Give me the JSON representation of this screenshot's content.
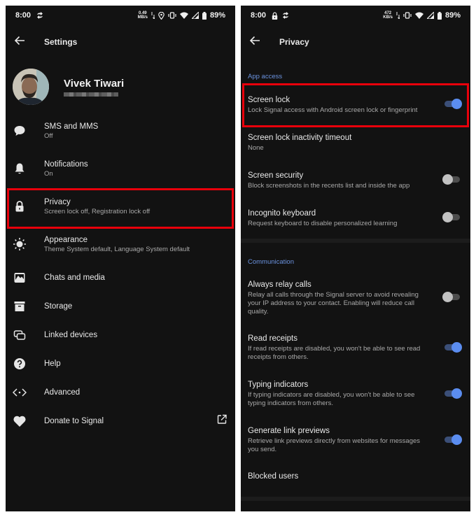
{
  "left": {
    "status_bar": {
      "time": "8:00",
      "net_speed_value": "0.49",
      "net_speed_unit": "MB/s",
      "battery": "89%"
    },
    "app_bar": {
      "title": "Settings"
    },
    "profile": {
      "name": "Vivek Tiwari"
    },
    "menu": [
      {
        "label": "SMS and MMS",
        "sub": "Off",
        "icon": "chat-bubble-icon"
      },
      {
        "label": "Notifications",
        "sub": "On",
        "icon": "bell-icon"
      },
      {
        "label": "Privacy",
        "sub": "Screen lock off, Registration lock off",
        "icon": "lock-icon",
        "highlighted": true
      },
      {
        "label": "Appearance",
        "sub": "Theme System default, Language System default",
        "icon": "brightness-icon"
      },
      {
        "label": "Chats and media",
        "icon": "image-icon"
      },
      {
        "label": "Storage",
        "icon": "archive-icon"
      },
      {
        "label": "Linked devices",
        "icon": "linked-devices-icon"
      },
      {
        "label": "Help",
        "icon": "help-icon"
      },
      {
        "label": "Advanced",
        "icon": "code-icon"
      },
      {
        "label": "Donate to Signal",
        "icon": "heart-icon",
        "trailing_icon": "external-link-icon"
      }
    ]
  },
  "right": {
    "status_bar": {
      "time": "8:00",
      "net_speed_value": "472",
      "net_speed_unit": "KB/s",
      "battery": "89%"
    },
    "app_bar": {
      "title": "Privacy"
    },
    "sections": [
      {
        "title": "App access",
        "items": [
          {
            "label": "Screen lock",
            "sub": "Lock Signal access with Android screen lock or fingerprint",
            "toggle": true,
            "highlighted": true
          },
          {
            "label": "Screen lock inactivity timeout",
            "sub": "None"
          },
          {
            "label": "Screen security",
            "sub": "Block screenshots in the recents list and inside the app",
            "toggle": false
          },
          {
            "label": "Incognito keyboard",
            "sub": "Request keyboard to disable personalized learning",
            "toggle": false
          }
        ]
      },
      {
        "title": "Communication",
        "items": [
          {
            "label": "Always relay calls",
            "sub": "Relay all calls through the Signal server to avoid revealing your IP address to your contact. Enabling will reduce call quality.",
            "toggle": false
          },
          {
            "label": "Read receipts",
            "sub": "If read receipts are disabled, you won't be able to see read receipts from others.",
            "toggle": true
          },
          {
            "label": "Typing indicators",
            "sub": "If typing indicators are disabled, you won't be able to see typing indicators from others.",
            "toggle": true
          },
          {
            "label": "Generate link previews",
            "sub": "Retrieve link previews directly from websites for messages you send.",
            "toggle": true
          },
          {
            "label": "Blocked users"
          }
        ]
      }
    ]
  },
  "colors": {
    "background": "#121212",
    "accent": "#5b8df0",
    "section_title": "#6b93e0",
    "highlight": "#e8000b"
  }
}
